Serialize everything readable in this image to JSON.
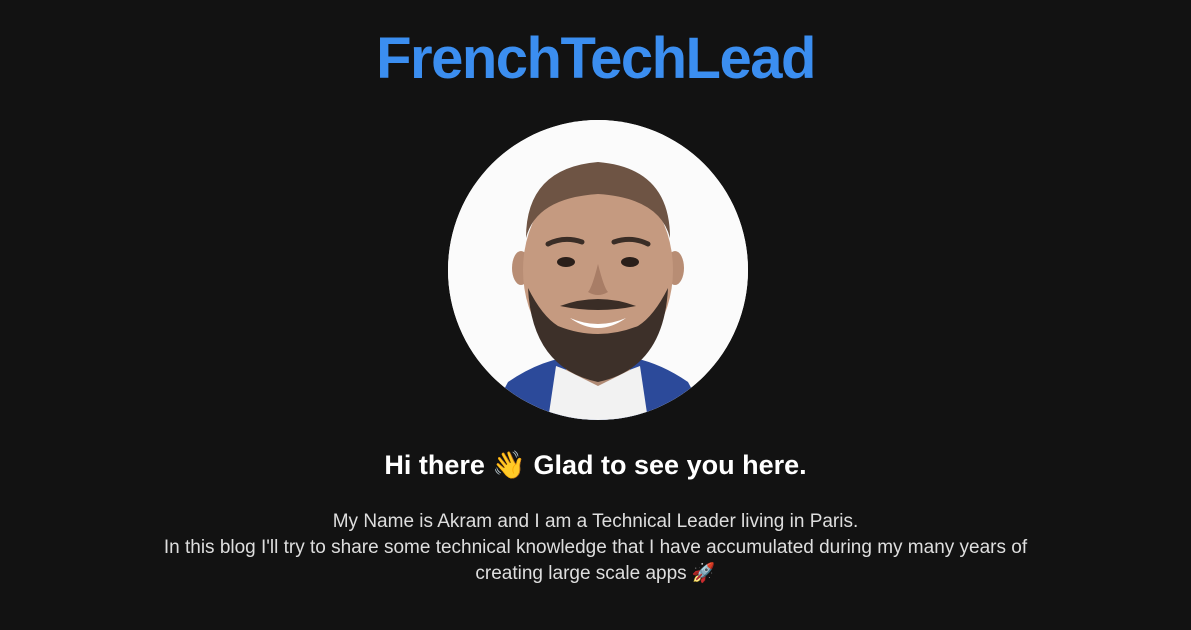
{
  "site": {
    "title": "FrenchTechLead"
  },
  "hero": {
    "avatar_icon": "profile-photo",
    "greeting": "Hi there 👋 Glad to see you here.",
    "bio_lines": [
      "My Name is Akram and I am a Technical Leader living in Paris.",
      "In this blog I'll try to share some technical knowledge that I have accumulated during my many years of",
      "creating large scale apps 🚀"
    ]
  },
  "colors": {
    "background": "#121212",
    "title_accent": "#3b8ef0",
    "greeting_text": "#ffffff",
    "body_text": "#dedede"
  }
}
